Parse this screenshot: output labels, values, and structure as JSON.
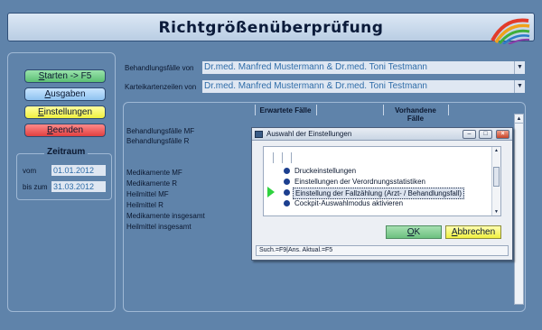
{
  "window": {
    "title": "Richtgrößenüberprüfung"
  },
  "buttons": {
    "start": {
      "label_prefix": "S",
      "label_rest": "tarten -> F5"
    },
    "output": {
      "label_prefix": "A",
      "label_rest": "usgaben"
    },
    "settings": {
      "label_prefix": "E",
      "label_rest": "instellungen"
    },
    "quit": {
      "label_prefix": "B",
      "label_rest": "eenden"
    }
  },
  "zeitraum": {
    "legend": "Zeitraum",
    "from_label": "vom",
    "from_value": "01.01.2012",
    "to_label": "bis zum",
    "to_value": "31.03.2012"
  },
  "filters": {
    "behandlungsfaelle_label": "Behandlungsfälle von",
    "behandlungsfaelle_value": "Dr.med. Manfred Mustermann & Dr.med. Toni Testmann",
    "karteikarten_label": "Karteikartenzeilen von",
    "karteikarten_value": "Dr.med. Manfred Mustermann & Dr.med. Toni Testmann"
  },
  "table": {
    "col_expected": "Erwartete Fälle",
    "col_existing_1": "Vorhandene",
    "col_existing_2": "Fälle",
    "rows": [
      "Behandlungsfälle MF",
      "Behandlungsfälle R",
      "Medikamente MF",
      "Medikamente R",
      "Heilmittel MF",
      "Heilmittel R",
      "Medikamente insgesamt",
      "Heilmittel insgesamt"
    ]
  },
  "dialog": {
    "title": "Auswahl der Einstellungen",
    "items": [
      "Druckeinstellungen",
      "Einstellungen der Verordnungsstatistiken",
      "Einstellung der Fallzählung (Arzt- / Behandlungsfall)",
      "Cockpit-Auswahlmodus aktivieren"
    ],
    "selected_index": 2,
    "ok_prefix": "O",
    "ok_rest": "K",
    "cancel_prefix": "A",
    "cancel_rest": "bbrechen",
    "status": "Such.=F9|Ans. Aktual.=F5"
  },
  "colors": {
    "background": "#5f83aa",
    "field_text": "#2e6ca8",
    "start": "#6cc07f",
    "output": "#8fc2f0",
    "settings": "#f0f040",
    "quit": "#e04040"
  }
}
